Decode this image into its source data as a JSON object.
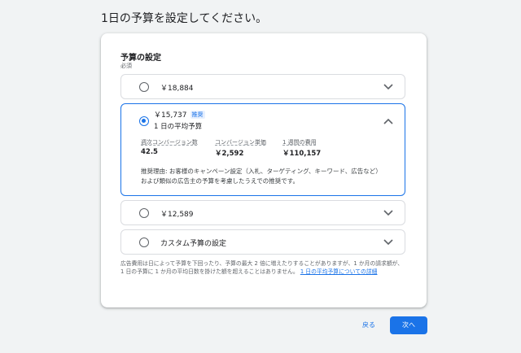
{
  "page": {
    "title": "1日の予算を設定してください。"
  },
  "budget_section": {
    "title": "予算の設定",
    "required": "必須",
    "options": [
      {
        "label": "￥18,884",
        "selected": false,
        "expanded": false
      },
      {
        "label": "￥15,737",
        "badge": "推奨",
        "sublabel": "1 日の平均予算",
        "selected": true,
        "expanded": true,
        "metrics": [
          {
            "label": "週次コンバージョン数",
            "value": "42.5"
          },
          {
            "label": "コンバージョン単価",
            "value": "￥2,592"
          },
          {
            "label": "1 週間の費用",
            "value": "￥110,157"
          }
        ],
        "reason": "推奨理由: お客様のキャンペーン設定（入札、ターゲティング、キーワード、広告など）および類似の広告主の予算を考慮したうえでの推奨です。"
      },
      {
        "label": "￥12,589",
        "selected": false,
        "expanded": false
      },
      {
        "label": "カスタム予算の設定",
        "selected": false,
        "expanded": false
      }
    ],
    "note_text": "広告費用は日によって予算を下回ったり、予算の最大 2 倍に増えたりすることがありますが、1 か月の請求額が、1 日の予算に 1 か月の平均日数を掛けた額を超えることはありません。",
    "note_link": "1 日の平均予算についての詳細"
  },
  "footer": {
    "back_label": "戻る",
    "next_label": "次へ"
  },
  "colors": {
    "accent": "#1a73e8",
    "border": "#dadce0",
    "background": "#f1f3f4"
  },
  "icons": {
    "radio": "radio-icon",
    "chevron_down": "chevron-down-icon",
    "chevron_up": "chevron-up-icon"
  }
}
